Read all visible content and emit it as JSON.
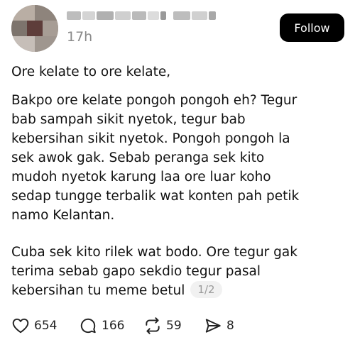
{
  "post": {
    "time": "17h",
    "follow_label": "Follow",
    "paragraphs": [
      "Ore kelate to ore kelate,",
      "Bakpo ore kelate pongoh pongoh eh? Tegur\nbab sampah sikit nyetok, tegur bab\nkebersihan sikit nyetok. Pongoh pongoh la\nsek awok gak. Sebab peranga sek kito\nmudoh nyetok karung laa ore luar koho\nsedap tungge terbalik wat konten pah petik\nnamo Kelantan.",
      "Cuba sek kito rilek wat bodo. Ore tegur gak\nterima sebab gapo sekdio tegur pasal\nkebersihan tu meme betul"
    ],
    "page_indicator": "1/2"
  },
  "actions": {
    "likes": "654",
    "comments": "166",
    "reposts": "59",
    "shares": "8"
  },
  "icons": {
    "like": "heart-icon",
    "comment": "comment-bubble-icon",
    "repost": "repost-icon",
    "share": "send-icon"
  },
  "colors": {
    "follow_bg": "#000000",
    "follow_text": "#ffffff",
    "muted_text": "#8a8a8a",
    "badge_bg": "#f1f1f1"
  }
}
